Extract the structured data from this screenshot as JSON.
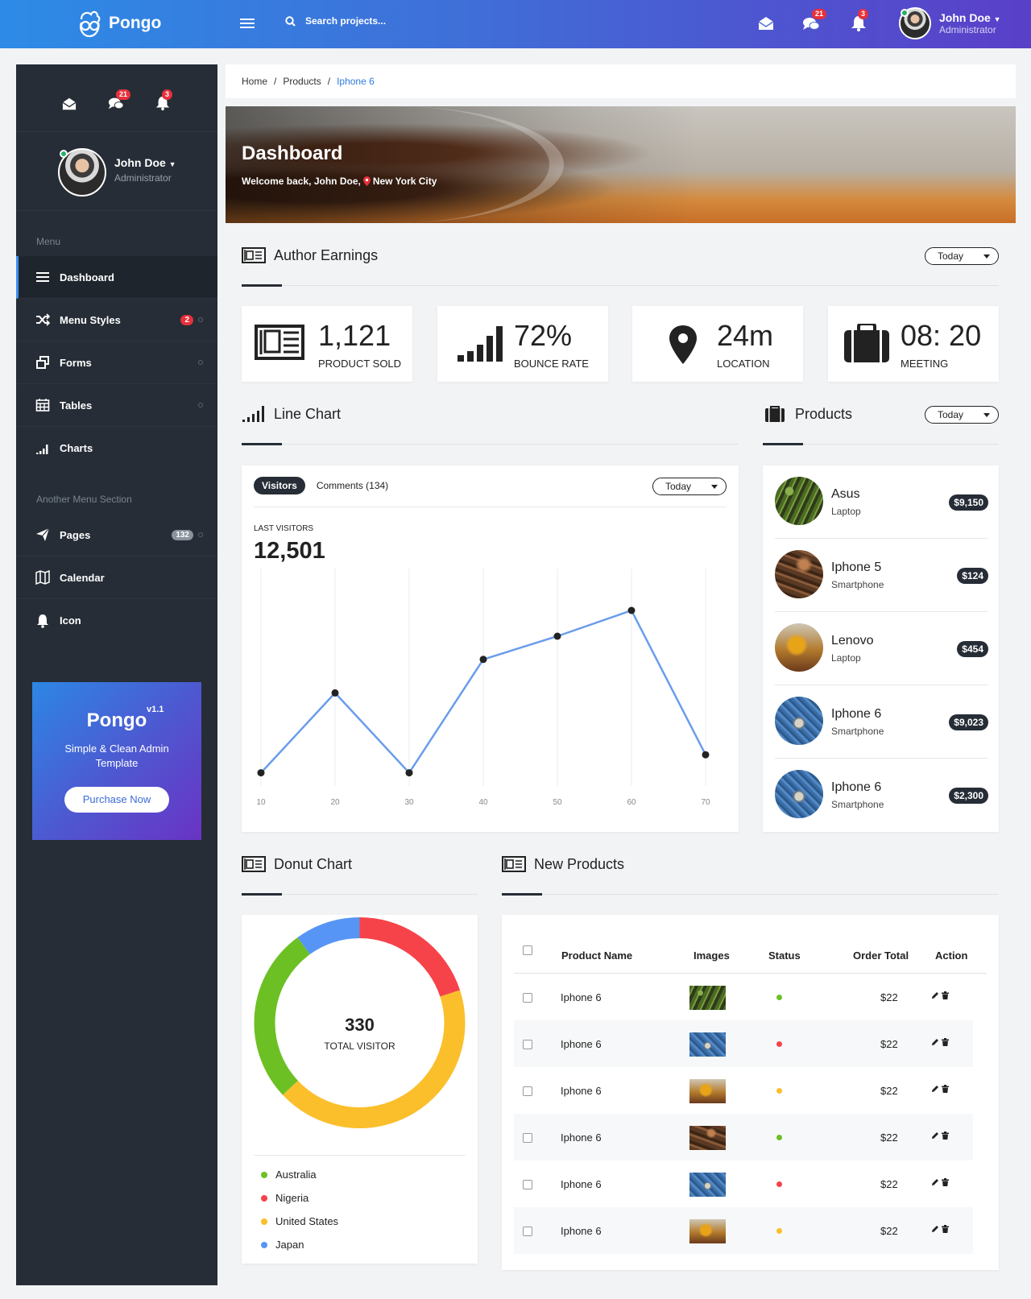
{
  "topbar": {
    "brand": "Pongo",
    "search_placeholder": "Search projects...",
    "messages_badge": "21",
    "notifications_badge": "3",
    "user": {
      "name": "John Doe",
      "role": "Administrator"
    }
  },
  "sidebar": {
    "messages_badge": "21",
    "notifications_badge": "3",
    "user": {
      "name": "John Doe",
      "role": "Administrator"
    },
    "section1": "Menu",
    "items": [
      {
        "label": "Dashboard",
        "icon": "menu-icon"
      },
      {
        "label": "Menu Styles",
        "icon": "shuffle-icon",
        "badge": "2"
      },
      {
        "label": "Forms",
        "icon": "forms-icon"
      },
      {
        "label": "Tables",
        "icon": "calendar-grid-icon"
      },
      {
        "label": "Charts",
        "icon": "signal-icon"
      }
    ],
    "section2": "Another Menu Section",
    "items2": [
      {
        "label": "Pages",
        "icon": "paper-plane-icon",
        "badge": "132"
      },
      {
        "label": "Calendar",
        "icon": "map-icon"
      },
      {
        "label": "Icon",
        "icon": "bell-icon"
      }
    ],
    "promo": {
      "name": "Pongo",
      "version": "v1.1",
      "tagline": "Simple & Clean Admin Template",
      "button": "Purchase Now"
    }
  },
  "breadcrumb": [
    "Home",
    "Products",
    "Iphone 6"
  ],
  "hero": {
    "title": "Dashboard",
    "subtitle_prefix": "Welcome back, John Doe,",
    "location": "New York City"
  },
  "earnings": {
    "title": "Author Earnings",
    "filter": "Today",
    "stats": [
      {
        "value": "1,121",
        "label": "PRODUCT SOLD",
        "icon": "newspaper-icon"
      },
      {
        "value": "72%",
        "label": "BOUNCE RATE",
        "icon": "signal-icon"
      },
      {
        "value": "24m",
        "label": "LOCATION",
        "icon": "map-pin-icon"
      },
      {
        "value": "08: 20",
        "label": "MEETING",
        "icon": "briefcase-icon"
      }
    ]
  },
  "line_chart": {
    "title": "Line Chart",
    "tab_active": "Visitors",
    "tab_other": "Comments (134)",
    "filter": "Today",
    "kpi_label": "LAST VISITORS",
    "kpi_value": "12,501"
  },
  "chart_data": {
    "type": "line",
    "x": [
      10,
      20,
      30,
      40,
      50,
      60,
      70
    ],
    "values": [
      2,
      33,
      2,
      46,
      55,
      65,
      9
    ],
    "ylim": [
      0,
      75
    ],
    "color": "#6a9cec",
    "grid": "vertical"
  },
  "products": {
    "title": "Products",
    "filter": "Today",
    "items": [
      {
        "name": "Asus",
        "category": "Laptop",
        "price": "$9,150",
        "image": "asparagus"
      },
      {
        "name": "Iphone 5",
        "category": "Smartphone",
        "price": "$124",
        "image": "bark"
      },
      {
        "name": "Lenovo",
        "category": "Laptop",
        "price": "$454",
        "image": "excavator"
      },
      {
        "name": "Iphone 6",
        "category": "Smartphone",
        "price": "$9,023",
        "image": "jeans"
      },
      {
        "name": "Iphone 6",
        "category": "Smartphone",
        "price": "$2,300",
        "image": "jeans"
      }
    ]
  },
  "donut": {
    "title": "Donut Chart",
    "total": "330",
    "total_label": "TOTAL VISITOR",
    "segments": [
      {
        "name": "Australia",
        "color": "#6cc024",
        "value": 27
      },
      {
        "name": "Nigeria",
        "color": "#f6434a",
        "value": 20
      },
      {
        "name": "United States",
        "color": "#fbbf2c",
        "value": 43
      },
      {
        "name": "Japan",
        "color": "#5695f5",
        "value": 10
      }
    ]
  },
  "new_products": {
    "title": "New Products",
    "columns": [
      "Product Name",
      "Images",
      "Status",
      "Order Total",
      "Action"
    ],
    "rows": [
      {
        "name": "Iphone 6",
        "image": "asparagus",
        "status": "#6cc024",
        "total": "$22"
      },
      {
        "name": "Iphone 6",
        "image": "jeans",
        "status": "#f6434a",
        "total": "$22"
      },
      {
        "name": "Iphone 6",
        "image": "excavator",
        "status": "#fbbf2c",
        "total": "$22"
      },
      {
        "name": "Iphone 6",
        "image": "bark",
        "status": "#6cc024",
        "total": "$22"
      },
      {
        "name": "Iphone 6",
        "image": "jeans",
        "status": "#f6434a",
        "total": "$22"
      },
      {
        "name": "Iphone 6",
        "image": "excavator",
        "status": "#fbbf2c",
        "total": "$22"
      }
    ]
  }
}
